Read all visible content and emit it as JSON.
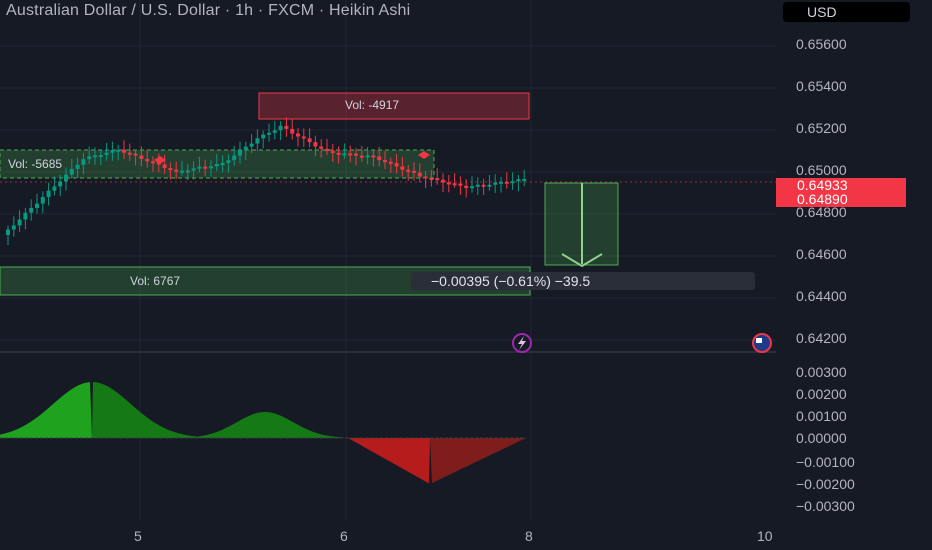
{
  "header": {
    "title": "Australian Dollar / U.S. Dollar · 1h · FXCM · Heikin Ashi",
    "currency": "USD"
  },
  "price_axis": {
    "labels": [
      "0.65600",
      "0.65400",
      "0.65200",
      "0.65000",
      "0.64800",
      "0.64600",
      "0.64400",
      "0.64200"
    ],
    "badge_top": "0.64933",
    "badge_bottom": "0.64890"
  },
  "indicator_axis": {
    "labels": [
      "0.00300",
      "0.00200",
      "0.00100",
      "0.00000",
      "−0.00100",
      "−0.00200",
      "−0.00300"
    ]
  },
  "time_axis": {
    "labels": [
      "5",
      "6",
      "8",
      "10"
    ]
  },
  "drawings": {
    "vol_top": "Vol: -4917",
    "vol_mid": "Vol: -5685",
    "vol_bottom": "Vol: 6767",
    "measure": "−0.00395 (−0.61%) −39.5"
  },
  "colors": {
    "background": "#161a25",
    "up": "#089981",
    "down": "#f23645",
    "hist_up": "#1fa31f",
    "hist_down": "#b71c1c"
  }
}
